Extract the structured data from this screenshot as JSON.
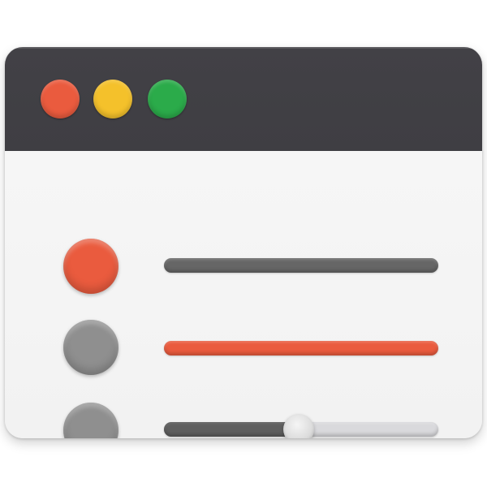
{
  "window": {
    "title": "",
    "titlebar_color": "#424146",
    "content_color": "#f2f2f2"
  },
  "traffic_lights": [
    {
      "name": "close",
      "color": "#ea5b3e"
    },
    {
      "name": "minimize",
      "color": "#f4c12b"
    },
    {
      "name": "maximize",
      "color": "#2bab4a"
    }
  ],
  "rows": [
    {
      "name": "row-1",
      "indicator_color": "#ea5b3e",
      "bar_color": "#666666"
    },
    {
      "name": "row-2",
      "indicator_color": "#8f8f8f",
      "bar_color": "#ea5b3e"
    },
    {
      "name": "row-3",
      "indicator_color": "#8f8f8f"
    }
  ],
  "slider": {
    "value": 0.49,
    "fill_color": "#5f5f5f",
    "track_color": "#d9d9dc",
    "thumb_color": "#dcdcdc"
  }
}
